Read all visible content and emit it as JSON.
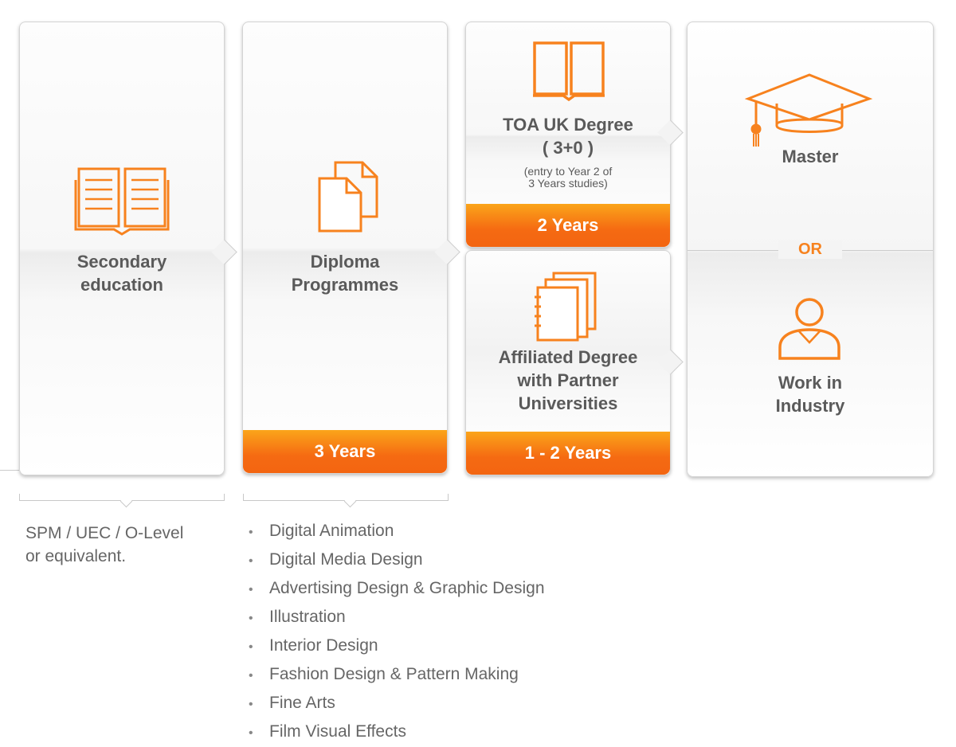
{
  "accent_color": "#f56a12",
  "cards": {
    "secondary": {
      "label_line1": "Secondary",
      "label_line2": "education",
      "icon": "open-book-icon"
    },
    "diploma": {
      "label_line1": "Diploma",
      "label_line2": "Programmes",
      "duration": "3 Years",
      "icon": "documents-icon"
    },
    "toa": {
      "label_line1": "TOA UK Degree",
      "label_line2": "( 3+0 )",
      "note_line1": "(entry to Year 2 of",
      "note_line2": "3 Years studies)",
      "duration": "2 Years",
      "icon": "book-icon"
    },
    "affiliated": {
      "label_line1": "Affiliated Degree",
      "label_line2": "with Partner",
      "label_line3": "Universities",
      "duration": "1 - 2 Years",
      "icon": "notebook-icon"
    },
    "outcome": {
      "master": "Master",
      "or": "OR",
      "work_line1": "Work in",
      "work_line2": "Industry",
      "master_icon": "graduation-cap-icon",
      "work_icon": "person-icon"
    }
  },
  "secondary_requirements": {
    "line1": "SPM / UEC / O-Level",
    "line2": "or equivalent."
  },
  "diploma_programmes": [
    "Digital Animation",
    "Digital Media Design",
    "Advertising Design & Graphic Design",
    "Illustration",
    "Interior Design",
    "Fashion Design & Pattern Making",
    "Fine Arts",
    "Film Visual Effects"
  ]
}
